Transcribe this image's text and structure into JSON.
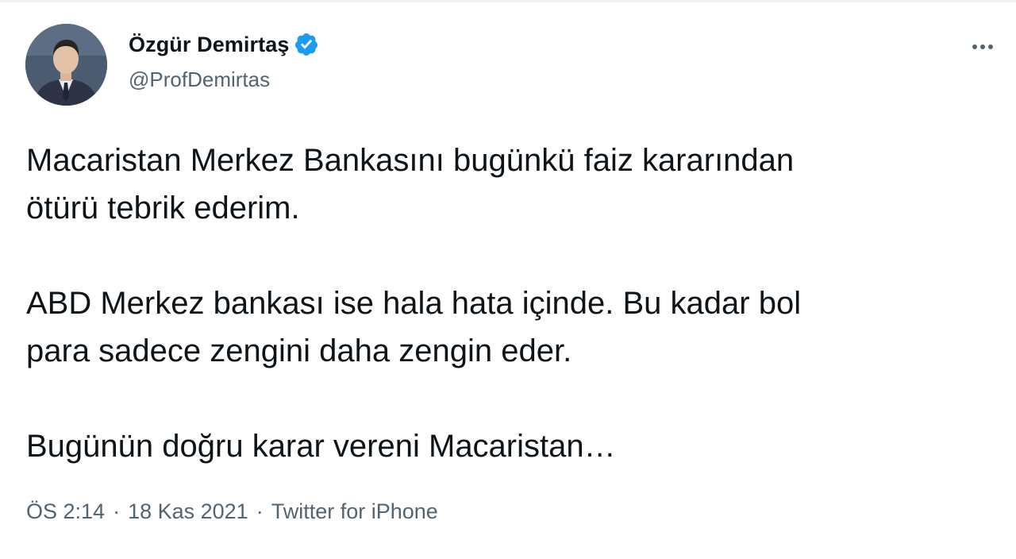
{
  "author": {
    "display_name": "Özgür Demirtaş",
    "handle": "@ProfDemirtas",
    "verified": true
  },
  "tweet": {
    "paragraphs": [
      "Macaristan Merkez Bankasını bugünkü faiz kararından\nötürü tebrik ederim.",
      "ABD Merkez bankası ise hala hata içinde. Bu kadar bol\npara sadece zengini daha zengin eder.",
      "Bugünün doğru karar vereni Macaristan…"
    ]
  },
  "meta": {
    "time": "ÖS 2:14",
    "separator": "·",
    "date": "18 Kas 2021",
    "source": "Twitter for iPhone"
  },
  "icons": {
    "verified": "verified-badge-icon",
    "more": "more-horizontal-icon"
  },
  "colors": {
    "verified": "#1d9bf0",
    "text": "#0f1419",
    "secondary": "#536471"
  }
}
